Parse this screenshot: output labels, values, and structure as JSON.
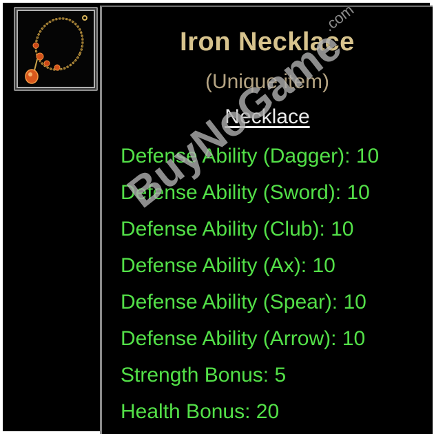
{
  "item": {
    "name": "Iron Necklace",
    "rarity": "(Unique item)",
    "category": "Necklace",
    "icon": "necklace-icon",
    "stats": [
      "Defense Ability (Dagger): 10",
      "Defense Ability (Sword): 10",
      "Defense Ability (Club): 10",
      "Defense Ability (Ax): 10",
      "Defense Ability (Spear): 10",
      "Defense Ability (Arrow): 10",
      "Strength Bonus: 5",
      "Health Bonus: 20"
    ]
  },
  "watermark": {
    "text": "BuyNoGame",
    "domain": ".com"
  },
  "colors": {
    "title": "#d7c38d",
    "rarity": "#b5a483",
    "category": "#ececec",
    "stat": "#53e048",
    "panel": "#000000",
    "border": "#8b8b8b"
  }
}
